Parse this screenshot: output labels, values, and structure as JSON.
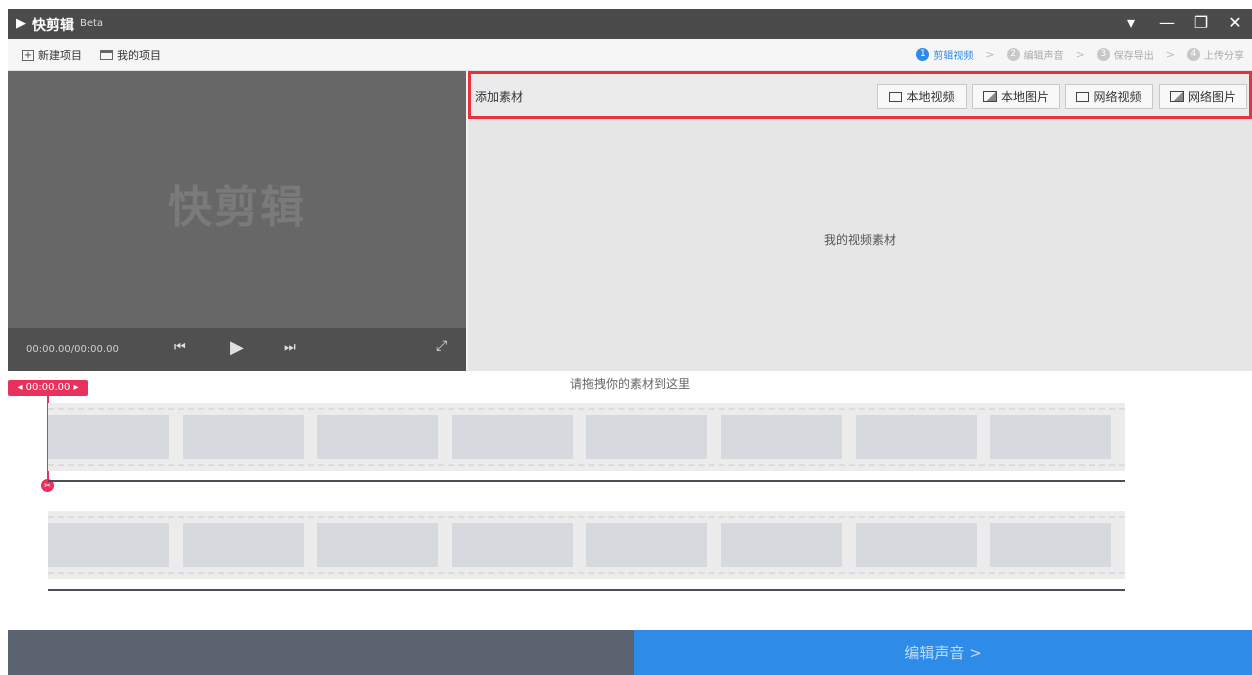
{
  "window": {
    "logo_mark": "▶",
    "app_name": "快剪辑",
    "beta": "Beta",
    "controls": {
      "menu": "▾",
      "minimize": "—",
      "restore": "❐",
      "close": "✕"
    }
  },
  "menu": {
    "new_project": "新建项目",
    "my_projects": "我的项目",
    "new_icon_glyph": "+"
  },
  "steps": [
    {
      "num": "1",
      "label": "剪辑视频",
      "active": true
    },
    {
      "num": "2",
      "label": "编辑声音",
      "active": false
    },
    {
      "num": "3",
      "label": "保存导出",
      "active": false
    },
    {
      "num": "4",
      "label": "上传分享",
      "active": false
    }
  ],
  "step_separator": ">",
  "preview": {
    "watermark": "快剪辑",
    "timecode": "00:00.00/00:00.00",
    "prev_glyph": "⏮",
    "play_glyph": "▶",
    "next_glyph": "⏭",
    "fullscreen_glyph": "⤢"
  },
  "material": {
    "title": "添加素材",
    "buttons": {
      "local_video": "本地视频",
      "local_image": "本地图片",
      "web_video": "网络视频",
      "web_image": "网络图片"
    },
    "empty_text": "我的视频素材"
  },
  "timeline": {
    "drop_hint": "请拖拽你的素材到这里",
    "playhead_time": "◂ 00:00.00 ▸",
    "playhead_glyph": "✂"
  },
  "footer": {
    "next_label": "编辑声音 >"
  },
  "colors": {
    "accent_blue": "#2e8be8",
    "highlight_red": "#e8313c",
    "playhead_pink": "#e8315d",
    "titlebar": "#4b4b4b"
  }
}
